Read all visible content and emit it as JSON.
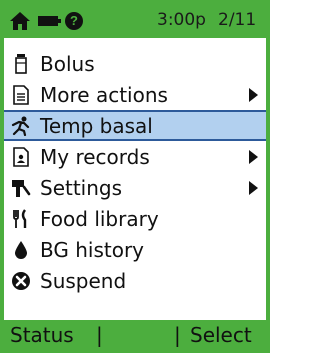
{
  "status_bar": {
    "icons": [
      "home-icon",
      "battery-icon",
      "help-icon"
    ],
    "time": "3:00p",
    "date": "2/11"
  },
  "menu": {
    "items": [
      {
        "label": "Bolus",
        "icon": "insulin-pen-icon",
        "submenu": false,
        "selected": false
      },
      {
        "label": "More actions",
        "icon": "document-list-icon",
        "submenu": true,
        "selected": false
      },
      {
        "label": "Temp basal",
        "icon": "running-person-icon",
        "submenu": false,
        "selected": true
      },
      {
        "label": "My records",
        "icon": "records-icon",
        "submenu": true,
        "selected": false
      },
      {
        "label": "Settings",
        "icon": "settings-tool-icon",
        "submenu": true,
        "selected": false
      },
      {
        "label": "Food library",
        "icon": "fork-knife-icon",
        "submenu": false,
        "selected": false
      },
      {
        "label": "BG history",
        "icon": "blood-drop-icon",
        "submenu": false,
        "selected": false
      },
      {
        "label": "Suspend",
        "icon": "suspend-x-icon",
        "submenu": false,
        "selected": false
      }
    ]
  },
  "softkeys": {
    "left": "Status",
    "separator": "|",
    "right": "Select"
  },
  "colors": {
    "accent_green": "#4cae3e",
    "selection_fill": "#b2d0ef",
    "selection_border": "#2d5a9a"
  }
}
